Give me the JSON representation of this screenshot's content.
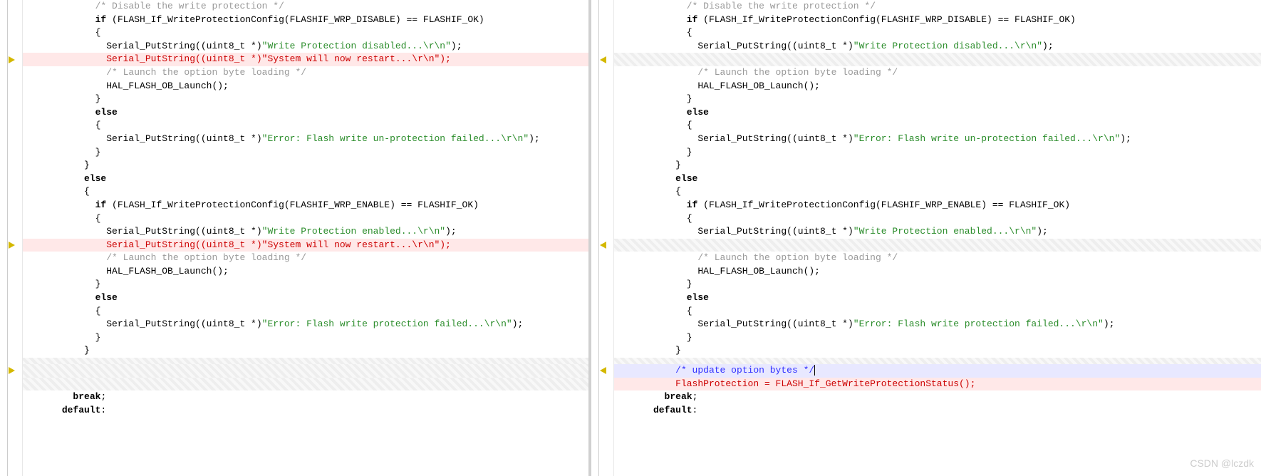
{
  "left_pane": {
    "lines": [
      {
        "type": "code",
        "indent": 6,
        "tokens": [
          {
            "t": "cmt",
            "v": "/* Disable the write protection */"
          }
        ]
      },
      {
        "type": "code",
        "indent": 6,
        "tokens": [
          {
            "t": "kw",
            "v": "if"
          },
          {
            "t": "op",
            "v": " (FLASH_If_WriteProtectionConfig(FLASHIF_WRP_DISABLE) == FLASHIF_OK)"
          }
        ]
      },
      {
        "type": "code",
        "indent": 6,
        "tokens": [
          {
            "t": "op",
            "v": "{"
          }
        ]
      },
      {
        "type": "code",
        "indent": 7,
        "tokens": [
          {
            "t": "fn",
            "v": "Serial_PutString((uint8_t *)"
          },
          {
            "t": "str",
            "v": "\"Write Protection disabled...\\r\\n\""
          },
          {
            "t": "op",
            "v": ");"
          }
        ]
      },
      {
        "type": "removed",
        "indent": 7,
        "text": "Serial_PutString((uint8_t *)\"System will now restart...\\r\\n\");",
        "marker": "right"
      },
      {
        "type": "code",
        "indent": 7,
        "tokens": [
          {
            "t": "cmt",
            "v": "/* Launch the option byte loading */"
          }
        ]
      },
      {
        "type": "code",
        "indent": 7,
        "tokens": [
          {
            "t": "fn",
            "v": "HAL_FLASH_OB_Launch();"
          }
        ]
      },
      {
        "type": "code",
        "indent": 6,
        "tokens": [
          {
            "t": "op",
            "v": "}"
          }
        ]
      },
      {
        "type": "code",
        "indent": 6,
        "tokens": [
          {
            "t": "kw",
            "v": "else"
          }
        ]
      },
      {
        "type": "code",
        "indent": 6,
        "tokens": [
          {
            "t": "op",
            "v": "{"
          }
        ]
      },
      {
        "type": "code",
        "indent": 7,
        "tokens": [
          {
            "t": "fn",
            "v": "Serial_PutString((uint8_t *)"
          },
          {
            "t": "str",
            "v": "\"Error: Flash write un-protection failed...\\r\\n\""
          },
          {
            "t": "op",
            "v": ");"
          }
        ]
      },
      {
        "type": "code",
        "indent": 6,
        "tokens": [
          {
            "t": "op",
            "v": "}"
          }
        ]
      },
      {
        "type": "code",
        "indent": 5,
        "tokens": [
          {
            "t": "op",
            "v": "}"
          }
        ]
      },
      {
        "type": "code",
        "indent": 5,
        "tokens": [
          {
            "t": "kw",
            "v": "else"
          }
        ]
      },
      {
        "type": "code",
        "indent": 5,
        "tokens": [
          {
            "t": "op",
            "v": "{"
          }
        ]
      },
      {
        "type": "code",
        "indent": 6,
        "tokens": [
          {
            "t": "kw",
            "v": "if"
          },
          {
            "t": "op",
            "v": " (FLASH_If_WriteProtectionConfig(FLASHIF_WRP_ENABLE) == FLASHIF_OK)"
          }
        ]
      },
      {
        "type": "code",
        "indent": 6,
        "tokens": [
          {
            "t": "op",
            "v": "{"
          }
        ]
      },
      {
        "type": "code",
        "indent": 7,
        "tokens": [
          {
            "t": "fn",
            "v": "Serial_PutString((uint8_t *)"
          },
          {
            "t": "str",
            "v": "\"Write Protection enabled...\\r\\n\""
          },
          {
            "t": "op",
            "v": ");"
          }
        ]
      },
      {
        "type": "removed",
        "indent": 7,
        "text": "Serial_PutString((uint8_t *)\"System will now restart...\\r\\n\");",
        "marker": "right"
      },
      {
        "type": "code",
        "indent": 7,
        "tokens": [
          {
            "t": "cmt",
            "v": "/* Launch the option byte loading */"
          }
        ]
      },
      {
        "type": "code",
        "indent": 7,
        "tokens": [
          {
            "t": "fn",
            "v": "HAL_FLASH_OB_Launch();"
          }
        ]
      },
      {
        "type": "code",
        "indent": 6,
        "tokens": [
          {
            "t": "op",
            "v": "}"
          }
        ]
      },
      {
        "type": "code",
        "indent": 6,
        "tokens": [
          {
            "t": "kw",
            "v": "else"
          }
        ]
      },
      {
        "type": "code",
        "indent": 6,
        "tokens": [
          {
            "t": "op",
            "v": "{"
          }
        ]
      },
      {
        "type": "code",
        "indent": 7,
        "tokens": [
          {
            "t": "fn",
            "v": "Serial_PutString((uint8_t *)"
          },
          {
            "t": "str",
            "v": "\"Error: Flash write protection failed...\\r\\n\""
          },
          {
            "t": "op",
            "v": ");"
          }
        ]
      },
      {
        "type": "code",
        "indent": 6,
        "tokens": [
          {
            "t": "op",
            "v": "}"
          }
        ]
      },
      {
        "type": "code",
        "indent": 5,
        "tokens": [
          {
            "t": "op",
            "v": "}"
          }
        ]
      },
      {
        "type": "folded"
      },
      {
        "type": "missing",
        "marker": "right"
      },
      {
        "type": "missing"
      },
      {
        "type": "code",
        "indent": 4,
        "tokens": [
          {
            "t": "kw",
            "v": "break"
          },
          {
            "t": "op",
            "v": ";"
          }
        ]
      },
      {
        "type": "code",
        "indent": 3,
        "tokens": [
          {
            "t": "kw",
            "v": "default"
          },
          {
            "t": "op",
            "v": ":"
          }
        ]
      }
    ]
  },
  "right_pane": {
    "lines": [
      {
        "type": "code",
        "indent": 6,
        "tokens": [
          {
            "t": "cmt",
            "v": "/* Disable the write protection */"
          }
        ]
      },
      {
        "type": "code",
        "indent": 6,
        "tokens": [
          {
            "t": "kw",
            "v": "if"
          },
          {
            "t": "op",
            "v": " (FLASH_If_WriteProtectionConfig(FLASHIF_WRP_DISABLE) == FLASHIF_OK)"
          }
        ]
      },
      {
        "type": "code",
        "indent": 6,
        "tokens": [
          {
            "t": "op",
            "v": "{"
          }
        ]
      },
      {
        "type": "code",
        "indent": 7,
        "tokens": [
          {
            "t": "fn",
            "v": "Serial_PutString((uint8_t *)"
          },
          {
            "t": "str",
            "v": "\"Write Protection disabled...\\r\\n\""
          },
          {
            "t": "op",
            "v": ");"
          }
        ]
      },
      {
        "type": "missing",
        "marker": "left"
      },
      {
        "type": "code",
        "indent": 7,
        "tokens": [
          {
            "t": "cmt",
            "v": "/* Launch the option byte loading */"
          }
        ]
      },
      {
        "type": "code",
        "indent": 7,
        "tokens": [
          {
            "t": "fn",
            "v": "HAL_FLASH_OB_Launch();"
          }
        ]
      },
      {
        "type": "code",
        "indent": 6,
        "tokens": [
          {
            "t": "op",
            "v": "}"
          }
        ]
      },
      {
        "type": "code",
        "indent": 6,
        "tokens": [
          {
            "t": "kw",
            "v": "else"
          }
        ]
      },
      {
        "type": "code",
        "indent": 6,
        "tokens": [
          {
            "t": "op",
            "v": "{"
          }
        ]
      },
      {
        "type": "code",
        "indent": 7,
        "tokens": [
          {
            "t": "fn",
            "v": "Serial_PutString((uint8_t *)"
          },
          {
            "t": "str",
            "v": "\"Error: Flash write un-protection failed...\\r\\n\""
          },
          {
            "t": "op",
            "v": ");"
          }
        ]
      },
      {
        "type": "code",
        "indent": 6,
        "tokens": [
          {
            "t": "op",
            "v": "}"
          }
        ]
      },
      {
        "type": "code",
        "indent": 5,
        "tokens": [
          {
            "t": "op",
            "v": "}"
          }
        ]
      },
      {
        "type": "code",
        "indent": 5,
        "tokens": [
          {
            "t": "kw",
            "v": "else"
          }
        ]
      },
      {
        "type": "code",
        "indent": 5,
        "tokens": [
          {
            "t": "op",
            "v": "{"
          }
        ]
      },
      {
        "type": "code",
        "indent": 6,
        "tokens": [
          {
            "t": "kw",
            "v": "if"
          },
          {
            "t": "op",
            "v": " (FLASH_If_WriteProtectionConfig(FLASHIF_WRP_ENABLE) == FLASHIF_OK)"
          }
        ]
      },
      {
        "type": "code",
        "indent": 6,
        "tokens": [
          {
            "t": "op",
            "v": "{"
          }
        ]
      },
      {
        "type": "code",
        "indent": 7,
        "tokens": [
          {
            "t": "fn",
            "v": "Serial_PutString((uint8_t *)"
          },
          {
            "t": "str",
            "v": "\"Write Protection enabled...\\r\\n\""
          },
          {
            "t": "op",
            "v": ");"
          }
        ]
      },
      {
        "type": "missing",
        "marker": "left"
      },
      {
        "type": "code",
        "indent": 7,
        "tokens": [
          {
            "t": "cmt",
            "v": "/* Launch the option byte loading */"
          }
        ]
      },
      {
        "type": "code",
        "indent": 7,
        "tokens": [
          {
            "t": "fn",
            "v": "HAL_FLASH_OB_Launch();"
          }
        ]
      },
      {
        "type": "code",
        "indent": 6,
        "tokens": [
          {
            "t": "op",
            "v": "}"
          }
        ]
      },
      {
        "type": "code",
        "indent": 6,
        "tokens": [
          {
            "t": "kw",
            "v": "else"
          }
        ]
      },
      {
        "type": "code",
        "indent": 6,
        "tokens": [
          {
            "t": "op",
            "v": "{"
          }
        ]
      },
      {
        "type": "code",
        "indent": 7,
        "tokens": [
          {
            "t": "fn",
            "v": "Serial_PutString((uint8_t *)"
          },
          {
            "t": "str",
            "v": "\"Error: Flash write protection failed...\\r\\n\""
          },
          {
            "t": "op",
            "v": ");"
          }
        ]
      },
      {
        "type": "code",
        "indent": 6,
        "tokens": [
          {
            "t": "op",
            "v": "}"
          }
        ]
      },
      {
        "type": "code",
        "indent": 5,
        "tokens": [
          {
            "t": "op",
            "v": "}"
          }
        ]
      },
      {
        "type": "folded"
      },
      {
        "type": "moved",
        "indent": 5,
        "text": "/* update option bytes */",
        "cursor": true,
        "marker": "left"
      },
      {
        "type": "added",
        "indent": 5,
        "text": "FlashProtection = FLASH_If_GetWriteProtectionStatus();"
      },
      {
        "type": "code",
        "indent": 4,
        "tokens": [
          {
            "t": "kw",
            "v": "break"
          },
          {
            "t": "op",
            "v": ";"
          }
        ]
      },
      {
        "type": "code",
        "indent": 3,
        "tokens": [
          {
            "t": "kw",
            "v": "default"
          },
          {
            "t": "op",
            "v": ":"
          }
        ]
      }
    ]
  },
  "watermark": "CSDN @lczdk"
}
